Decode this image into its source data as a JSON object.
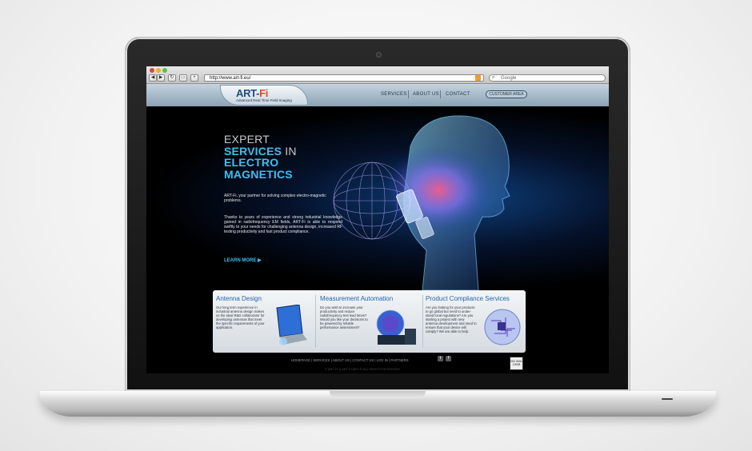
{
  "browser": {
    "url": "http://www.art-fi.eu/",
    "search_placeholder": "Google",
    "back_icon": "◀",
    "forward_icon": "▶",
    "reload_icon": "↻",
    "add_icon": "+"
  },
  "site": {
    "logo_text": "ART-",
    "logo_accent": "Fi",
    "logo_tagline": "Advanced Real Time Field Imaging",
    "nav": [
      "SERVICES",
      "ABOUT US",
      "CONTACT"
    ],
    "customer_area": "CUSTOMER AREA"
  },
  "hero": {
    "line1": "EXPERT",
    "line2_blue": "SERVICES",
    "line2_gray": " IN",
    "line3": "ELECTRO",
    "line4": "MAGNETICS",
    "intro": "ART-Fi, your partner for solving complex electro-magnetic problems.",
    "paragraph": "Thanks to years of experience and strong industrial knowledge gained in radiofrequency EM fields, ART-Fi is able to respond swiftly to your needs for challenging antenna design, increased RF testing productivity and fast product compliance.",
    "learn_more": "LEARN MORE ▶"
  },
  "cards": [
    {
      "title": "Antenna Design",
      "text": "Our long term experience in industrial antenna design makes us the ideal R&D collaborator for developing antennas that meet the specific requirements of your application."
    },
    {
      "title": "Measurement Automation",
      "text": "Do you wish to increase your productivity and reduce radiofrequency test lead times? Would you like your decisions to be powered by reliable performance assessment?"
    },
    {
      "title": "Product Compliance Services",
      "text": "Are you looking for your products to go global but need to under-stand local regulations? Are you starting a project with new antenna development and need to ensure that your device will comply? We are able to help."
    }
  ],
  "footer": {
    "links": "HOMEPAGE | SERVICES | ABOUT US | CONTACT US | LOG IN | PARTNERS",
    "copyright": "© ART-FI & ART-FI ART-Fi ALL RIGHTS RESERVED",
    "twitter": "t",
    "facebook": "f",
    "iso_badge": "ISO 9001 12008"
  },
  "colors": {
    "accent_blue": "#3cc0f2",
    "logo_red": "#e24a27",
    "header_blue": "#8aa2b4"
  }
}
